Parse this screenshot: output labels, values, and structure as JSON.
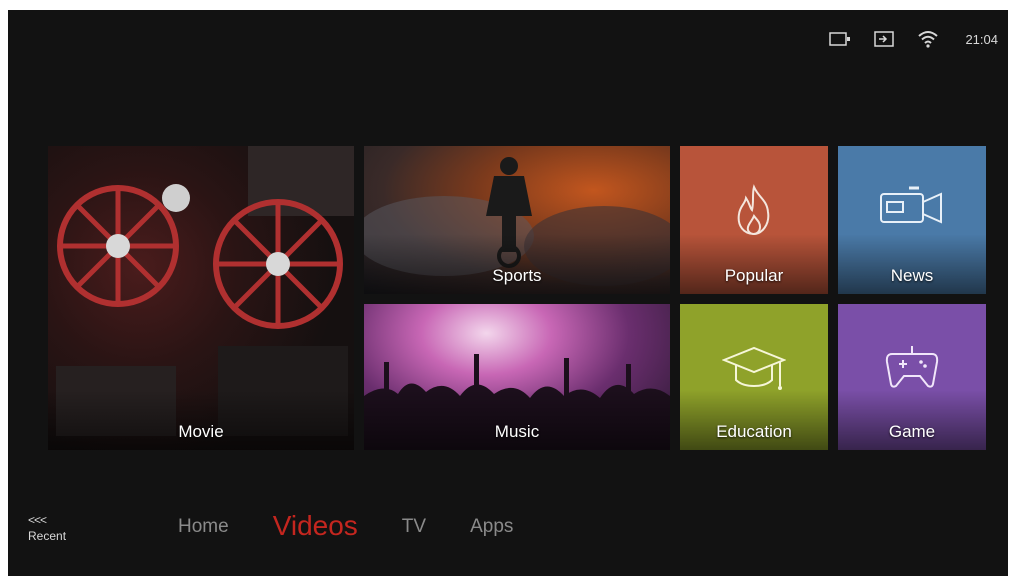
{
  "status_bar": {
    "icons": [
      "screen-icon",
      "input-source-icon",
      "wifi-icon"
    ],
    "time": "21:04"
  },
  "tiles": [
    {
      "label": "Movie"
    },
    {
      "label": "Sports"
    },
    {
      "label": "Music"
    },
    {
      "label": "Popular",
      "icon": "flame-icon",
      "color": "#b8543a"
    },
    {
      "label": "News",
      "icon": "camera-icon",
      "color": "#4a7aa8"
    },
    {
      "label": "Education",
      "icon": "graduation-cap-icon",
      "color": "#8fa22a"
    },
    {
      "label": "Game",
      "icon": "gamepad-icon",
      "color": "#7a4fa8"
    }
  ],
  "recent": {
    "chevrons": "<<<",
    "label": "Recent"
  },
  "nav": {
    "items": [
      {
        "label": "Home"
      },
      {
        "label": "Videos"
      },
      {
        "label": "TV"
      },
      {
        "label": "Apps"
      }
    ],
    "active_color": "#c4261f"
  }
}
